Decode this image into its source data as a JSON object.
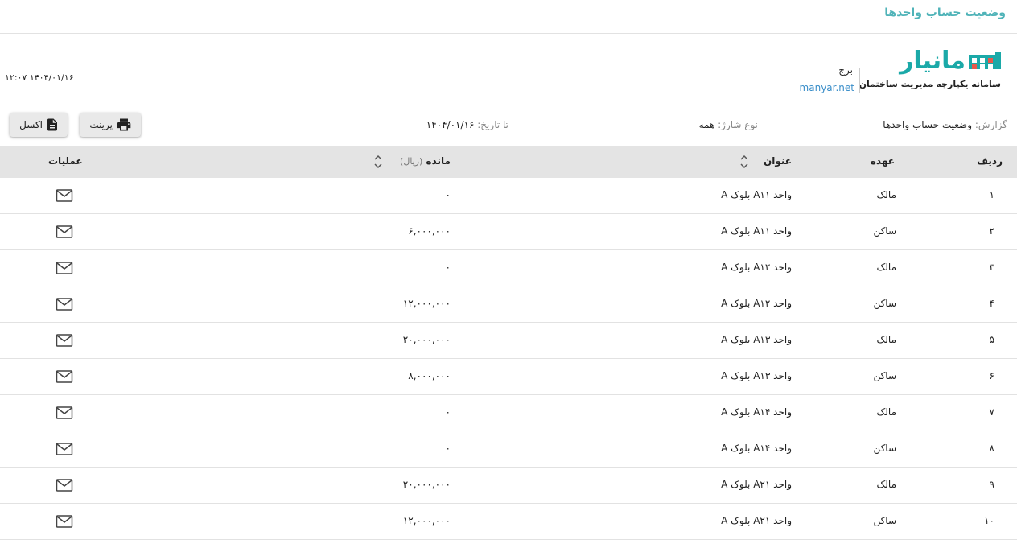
{
  "page": {
    "title": "وضعیت حساب واحدها"
  },
  "header": {
    "logo_text": "مانیار",
    "logo_subtitle": "سامانه یکپارچه مدیریت ساختمان",
    "building": "برج",
    "site": "manyar.net",
    "datetime": "۱۴۰۴/۰۱/۱۶ ۱۲:۰۷"
  },
  "filters": {
    "report_label": "گزارش:",
    "report_value": "وضعیت حساب واحدها",
    "charge_label": "نوع شارژ:",
    "charge_value": "همه",
    "date_label": "تا تاریخ:",
    "date_value": "۱۴۰۴/۰۱/۱۶"
  },
  "buttons": {
    "print": "پرینت",
    "excel": "اکسل"
  },
  "table": {
    "headers": {
      "row": "ردیف",
      "role": "عهده",
      "title": "عنوان",
      "balance": "مانده",
      "balance_unit": "(ریال)",
      "actions": "عملیات"
    },
    "rows": [
      {
        "num": "۱",
        "role": "مالک",
        "title": "واحد A۱۱ بلوک A",
        "balance": "۰"
      },
      {
        "num": "۲",
        "role": "ساکن",
        "title": "واحد A۱۱ بلوک A",
        "balance": "۶,۰۰۰,۰۰۰"
      },
      {
        "num": "۳",
        "role": "مالک",
        "title": "واحد A۱۲ بلوک A",
        "balance": "۰"
      },
      {
        "num": "۴",
        "role": "ساکن",
        "title": "واحد A۱۲ بلوک A",
        "balance": "۱۲,۰۰۰,۰۰۰"
      },
      {
        "num": "۵",
        "role": "مالک",
        "title": "واحد A۱۳ بلوک A",
        "balance": "۲۰,۰۰۰,۰۰۰"
      },
      {
        "num": "۶",
        "role": "ساکن",
        "title": "واحد A۱۳ بلوک A",
        "balance": "۸,۰۰۰,۰۰۰"
      },
      {
        "num": "۷",
        "role": "مالک",
        "title": "واحد A۱۴ بلوک A",
        "balance": "۰"
      },
      {
        "num": "۸",
        "role": "ساکن",
        "title": "واحد A۱۴ بلوک A",
        "balance": "۰"
      },
      {
        "num": "۹",
        "role": "مالک",
        "title": "واحد A۲۱ بلوک A",
        "balance": "۲۰,۰۰۰,۰۰۰"
      },
      {
        "num": "۱۰",
        "role": "ساکن",
        "title": "واحد A۲۱ بلوک A",
        "balance": "۱۲,۰۰۰,۰۰۰"
      }
    ]
  },
  "icons": {
    "print": "printer-icon",
    "excel": "document-icon",
    "row_action": "mail-icon",
    "sort": "sort-icon"
  },
  "colors": {
    "accent": "#1ba9a8",
    "title": "#4fb3b8",
    "header_bg": "#e4e4e4"
  }
}
